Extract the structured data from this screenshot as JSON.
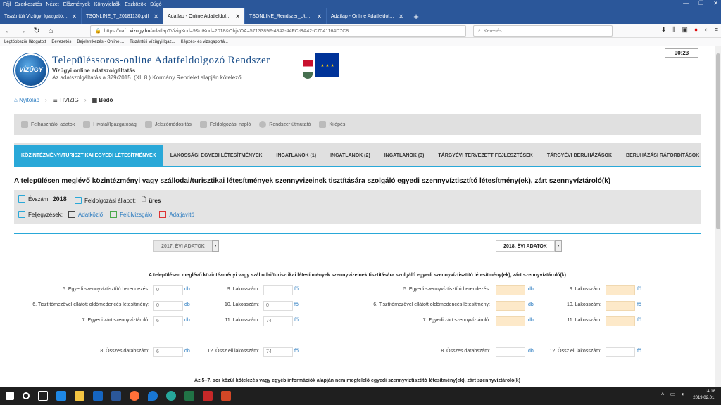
{
  "browser": {
    "menu": [
      "Fájl",
      "Szerkesztés",
      "Nézet",
      "Előzmények",
      "Könyvjelzők",
      "Eszközök",
      "Súgó"
    ],
    "tabs": [
      {
        "title": "Tiszántúli Vízügyi Igazgatóság",
        "active": false
      },
      {
        "title": "TSONLINE_T_20181130.pdf",
        "active": false
      },
      {
        "title": "Adatlap - Online Adatfeldolgoz",
        "active": true
      },
      {
        "title": "TSONLINE_Rendszer_Utmutato_20",
        "active": false
      },
      {
        "title": "Adatlap - Online Adatfeldolgoz",
        "active": false
      }
    ],
    "url_prefix": "https://oaf.",
    "url_host": "vizugy.hu",
    "url_rest": "/adatlap?VizigKod=9&otKod=2018&ObjVOA=5713389F-4842-44FC-BA42-C7041164D7C8",
    "search_placeholder": "Keresés",
    "bookmarks": [
      "Legtöbbször látogatott",
      "Bevezetés",
      "Bejelentkezés - Online ...",
      "Tiszántúli Vízügyi Igaz...",
      "Képzés- és vizsgaportá..."
    ]
  },
  "header": {
    "timer": "00:23",
    "logo_text": "VÍZÜGY",
    "title": "Településsoros-online Adatfeldolgozó Rendszer",
    "subtitle1": "Vízügyi online adatszolgáltatás",
    "subtitle2": "Az adatszolgáltatás a 379/2015. (XII.8.) Kormány Rendelet alapján kötelező"
  },
  "breadcrumb": [
    "Nyitólap",
    "TIVIZIG",
    "Bedő"
  ],
  "toolbar": [
    "Felhasználói adatok",
    "Hivatal/Igazgatóság",
    "Jelszómódosítás",
    "Feldolgozási napló",
    "Rendszer útmutató",
    "Kilépés"
  ],
  "page_tabs": [
    {
      "label": "KÖZINTÉZMÉNYI/TURISZTIKAI EGYEDI LÉTESÍTMÉNYEK",
      "active": true
    },
    {
      "label": "LAKOSSÁGI EGYEDI LÉTESÍTMÉNYEK",
      "active": false
    },
    {
      "label": "INGATLANOK (1)",
      "active": false
    },
    {
      "label": "INGATLANOK (2)",
      "active": false
    },
    {
      "label": "INGATLANOK (3)",
      "active": false
    },
    {
      "label": "TÁRGYÉVI TERVEZETT FEJLESZTÉSEK",
      "active": false
    },
    {
      "label": "TÁRGYÉVI BERUHÁZÁSOK",
      "active": false
    },
    {
      "label": "BERUHÁZÁSI RÁFORDÍTÁSOK",
      "active": false
    }
  ],
  "main_title": "A településen meglévő közintézményi vagy szállodai/turisztikai létesítmények szennyvizeinek tisztítására szolgáló egyedi szennyvíztisztító létesítmény(ek), zárt szennyvíztároló(k)",
  "info": {
    "year_label": "Évszám:",
    "year_value": "2018",
    "status_label": "Feldolgozási állapot:",
    "status_value": "üres",
    "notes_label": "Feljegyzések:",
    "notes": [
      "Adatközlő",
      "Felülvizsgáló",
      "Adatjavító"
    ]
  },
  "years": {
    "left": "2017. ÉVI ADATOK",
    "right": "2018. ÉVI ADATOK"
  },
  "section1_title": "A településen meglévő közintézményi vagy szállodai/turisztikai létesítmények szennyvizeinek tisztítására szolgáló egyedi szennyvíztisztító létesítmény(ek), zárt szennyvíztároló(k)",
  "section2_title": "Az 5–7. sor közül kötelezés vagy egyéb információk alapján nem megfelelő egyedi szennyvíztisztító létesítmény(ek), zárt szennyvíztároló(k)",
  "fields": {
    "l5": "5. Egyedi szennyvíztisztító berendezés:",
    "l6": "6. Tisztítómezővel ellátott oldómedencés létesítmény:",
    "l7": "7. Egyedi zárt szennyvíztároló:",
    "l9": "9. Lakosszám:",
    "l10": "10. Lakosszám:",
    "l11": "11. Lakosszám:",
    "l8": "8. Összes darabszám:",
    "l12": "12. Össz.ell.lakosszám:",
    "unit_db": "db",
    "unit_fo": "fő",
    "v2017": {
      "f5": "0",
      "f6": "0",
      "f7": "6",
      "f9": "",
      "f10": "0",
      "f11": "74",
      "f8": "6",
      "f12": "74"
    },
    "v2018": {
      "f5": "",
      "f6": "",
      "f7": "",
      "f9": "",
      "f10": "",
      "f11": "",
      "f8": "",
      "f12": ""
    }
  },
  "taskbar": {
    "time": "14:18",
    "date": "2019.02.01."
  }
}
